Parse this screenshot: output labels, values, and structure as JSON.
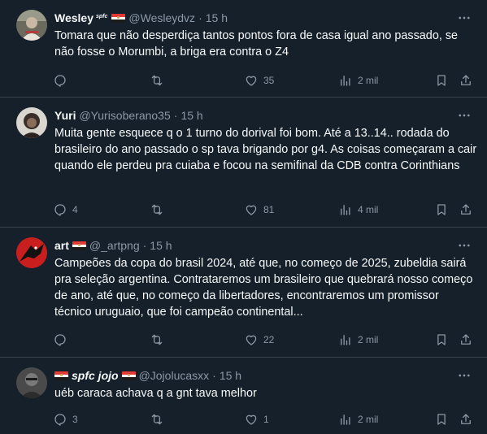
{
  "tweets": [
    {
      "display_name": "Wesley",
      "name_tag": "spfc",
      "handle": "@Wesleydvz",
      "dot": "·",
      "time": "15 h",
      "text": "Tomara que não desperdiça tantos pontos fora de casa igual ano passado, se não fosse o Morumbi, a briga era contra o Z4",
      "replies": "",
      "retweets": "",
      "likes": "35",
      "views": "2 mil"
    },
    {
      "display_name": "Yuri",
      "handle": "@Yurisoberano35",
      "dot": "·",
      "time": "15 h",
      "text": "Muita gente esquece q o 1 turno do dorival foi bom. Até a 13..14.. rodada do brasileiro do ano passado o sp tava brigando por g4. As coisas começaram a cair quando ele perdeu pra cuiaba e focou na semifinal da CDB contra Corinthians",
      "replies": "4",
      "retweets": "",
      "likes": "81",
      "views": "4 mil"
    },
    {
      "display_name": "art",
      "handle": "@_artpng",
      "dot": "·",
      "time": "15 h",
      "text": "Campeões da copa do brasil 2024, até que, no começo de 2025, zubeldia sairá pra seleção argentina. Contrataremos um brasileiro que quebrará nosso começo de ano, até que, no começo da libertadores, encontraremos um promissor técnico uruguaio, que foi campeão continental...",
      "replies": "",
      "retweets": "",
      "likes": "22",
      "views": "2 mil"
    },
    {
      "display_name": "spfc jojo",
      "handle": "@Jojolucasxx",
      "dot": "·",
      "time": "15 h",
      "text": "uéb caraca achava q a gnt tava melhor",
      "replies": "3",
      "retweets": "",
      "likes": "1",
      "views": "2 mil"
    }
  ],
  "colors": {
    "background": "#15202b",
    "text": "#f7f9f9",
    "muted": "#8b98a5",
    "divider": "#38444d"
  },
  "icons": {
    "reply": "reply-icon",
    "retweet": "retweet-icon",
    "like": "heart-icon",
    "views": "views-icon",
    "bookmark": "bookmark-icon",
    "share": "share-icon",
    "more": "more-icon",
    "flag": "flag-icon"
  }
}
